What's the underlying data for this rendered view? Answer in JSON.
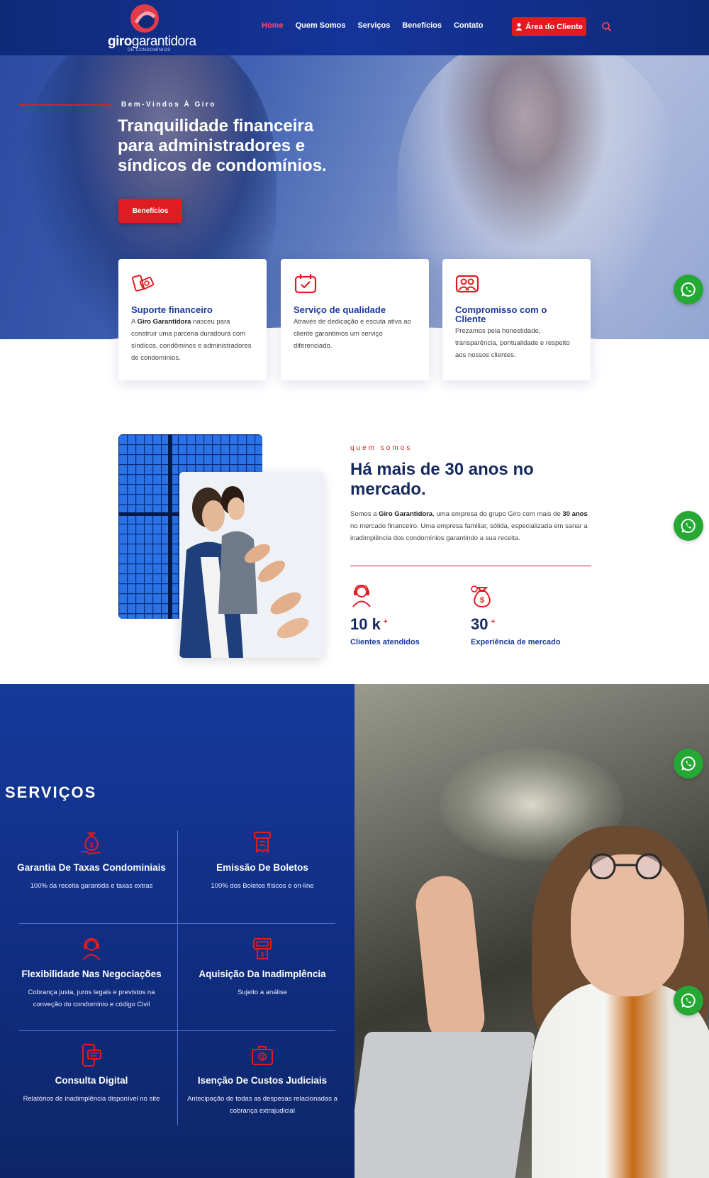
{
  "header": {
    "logo_bold": "giro",
    "logo_light": "garantidora",
    "logo_sub": "DE CONDOMÍNIOS",
    "nav": [
      "Home",
      "Quem Somos",
      "Serviços",
      "Benefícios",
      "Contato"
    ],
    "client_button": "Área do Cliente"
  },
  "hero": {
    "kicker": "Bem-Vindos À Giro",
    "title": "Tranquilidade financeira para administradores e síndicos de condomínios.",
    "button": "Benefícios"
  },
  "cards": [
    {
      "icon": "money-icon",
      "title": "Suporte financeiro",
      "text_pre": "A ",
      "text_bold": "Giro Garantidora",
      "text_post": " nasceu para construir uma parceria duradoura com síndicos, condôminos e administradores de condomínios."
    },
    {
      "icon": "calendar-check-icon",
      "title": "Serviço de qualidade",
      "text": "Através de dedicação e escuta ativa ao cliente garantimos um serviço diferenciado."
    },
    {
      "icon": "people-icon",
      "title": "Compromisso com o Cliente",
      "text": "Prezamos pela honestidade, transparência, pontualidade e respeito aos nossos clientes."
    }
  ],
  "about": {
    "kicker": "quem somos",
    "title": "Há mais de 30 anos no mercado.",
    "text_1": "Somos a ",
    "text_bold_1": "Giro Garantidora",
    "text_2": ", uma empresa do grupo Giro com mais de ",
    "text_bold_2": "30 anos",
    "text_3": " no mercado financeiro. Uma empresa familiar, sólida, especializada em sanar a inadimplência dos condomínios garantindo a sua receita.",
    "stats": [
      {
        "icon": "headset-agent-icon",
        "value": "10 k",
        "plus": "+",
        "label": "Clientes atendidos"
      },
      {
        "icon": "money-bag-icon",
        "value": "30",
        "plus": "+",
        "label": "Experiência de mercado"
      }
    ]
  },
  "services": {
    "title": "SERVIÇOS",
    "items": [
      {
        "icon": "money-bag-hand-icon",
        "title": "Garantia De Taxas Condominiais",
        "text": "100% da receita garantida e taxas extras"
      },
      {
        "icon": "invoice-icon",
        "title": "Emissão De Boletos",
        "text": "100% dos Boletos físicos e on-line"
      },
      {
        "icon": "support-agent-icon",
        "title": "Flexibilidade Nas Negociações",
        "text": "Cobrança justa, juros legais e previstos na conveção do condomínio e código Civil"
      },
      {
        "icon": "payment-machine-icon",
        "title": "Aquisição Da Inadimplência",
        "text": "Sujeito a análise"
      },
      {
        "icon": "mobile-report-icon",
        "title": "Consulta Digital",
        "text": "Relatórios de inadimplência disponível no site"
      },
      {
        "icon": "briefcase-money-icon",
        "title": "Isenção De Custos Judiciais",
        "text": "Antecipação de todas as despesas relacionadas a cobrança extrajudicial"
      }
    ]
  },
  "colors": {
    "brand_blue": "#14349a",
    "accent_red": "#e11b22",
    "whatsapp_green": "#25a834"
  }
}
